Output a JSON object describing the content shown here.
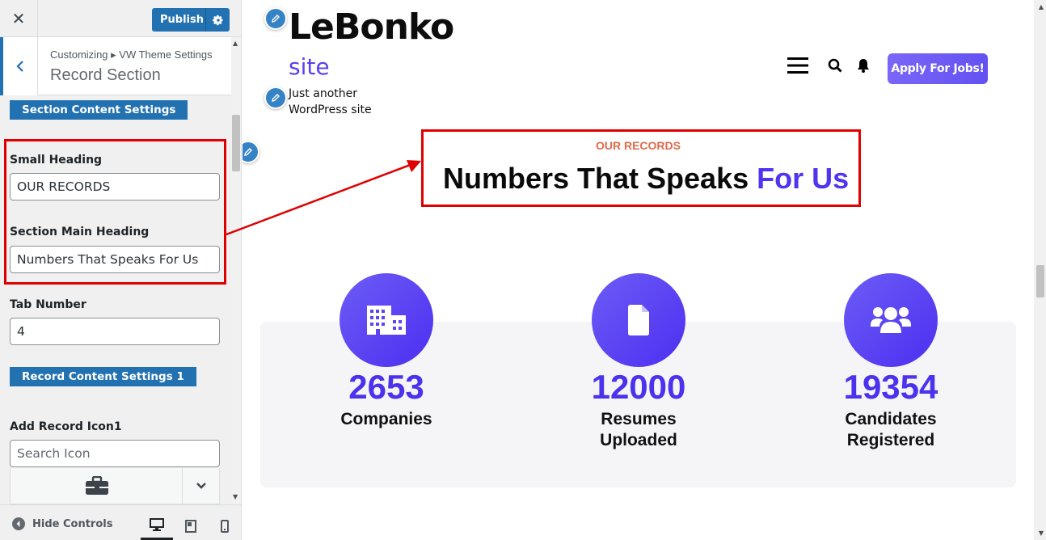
{
  "topbar": {
    "close_glyph": "✕",
    "publish_label": "Publish"
  },
  "section_header": {
    "breadcrumb": "Customizing ▸ VW Theme Settings",
    "title": "Record Section"
  },
  "panel": {
    "section_content_tag": "Section Content Settings",
    "small_heading_label": "Small Heading",
    "small_heading_value": "OUR RECORDS",
    "main_heading_label": "Section Main Heading",
    "main_heading_value": "Numbers That Speaks For Us",
    "tab_number_label": "Tab Number",
    "tab_number_value": "4",
    "record_content_tag": "Record Content Settings 1",
    "record_icon_label": "Add Record Icon1",
    "record_icon_placeholder": "Search Icon"
  },
  "footer": {
    "hide_controls": "Hide Controls"
  },
  "preview": {
    "site_title": "LeBonko",
    "site_title_line2": "site",
    "tagline": "Just another WordPress site",
    "apply_button": "Apply For Jobs!",
    "small_heading": "OUR RECORDS",
    "main_heading": "Numbers That Speaks ",
    "main_heading_accent": "For Us",
    "stats": [
      {
        "value": "2653",
        "label": "Companies",
        "icon": "building-icon"
      },
      {
        "value": "12000",
        "label": "Resumes Uploaded",
        "icon": "file-icon"
      },
      {
        "value": "19354",
        "label": "Candidates Registered",
        "icon": "users-icon"
      }
    ]
  },
  "colors": {
    "accent": "#5034f0",
    "wp_blue": "#2271b1",
    "highlight_red": "#e00000",
    "small_heading": "#e06a4c"
  }
}
